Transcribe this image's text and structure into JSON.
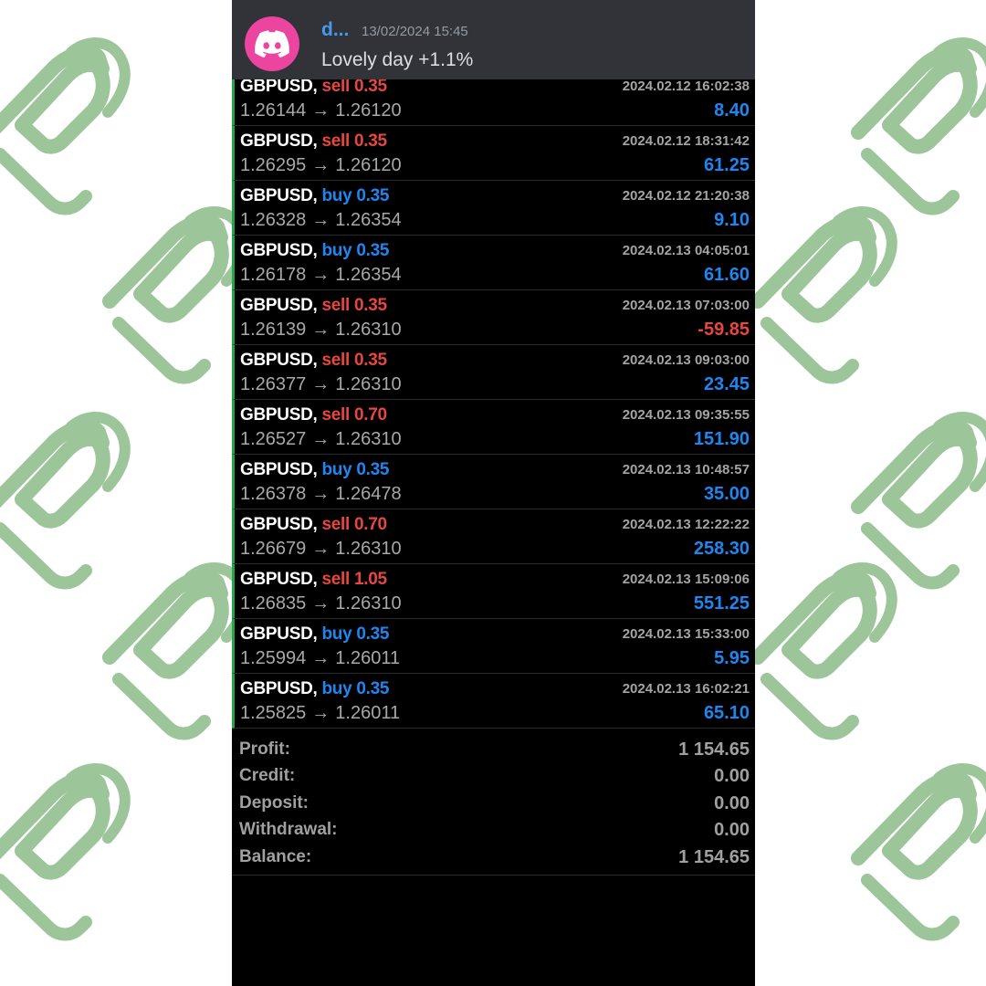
{
  "background": {
    "pattern_icon": "horned-logo-icon",
    "pattern_color": "#9cc59a",
    "page_color": "#ffffff"
  },
  "message": {
    "avatar_icon": "discord-icon",
    "avatar_color": "#eb459f",
    "username": "d...",
    "timestamp": "13/02/2024 15:45",
    "text": "Lovely day +1.1%"
  },
  "colors": {
    "sell": "#e8463e",
    "buy": "#1f86f0",
    "profit_positive": "#1f86f0",
    "profit_negative": "#e8463e"
  },
  "trades": [
    {
      "symbol": "GBPUSD,",
      "side": "sell",
      "lots": "0.35",
      "datetime": "2024.02.12 16:02:38",
      "open": "1.26144",
      "close": "1.26120",
      "arrow": "→",
      "profit": "8.40"
    },
    {
      "symbol": "GBPUSD,",
      "side": "sell",
      "lots": "0.35",
      "datetime": "2024.02.12 18:31:42",
      "open": "1.26295",
      "close": "1.26120",
      "arrow": "→",
      "profit": "61.25"
    },
    {
      "symbol": "GBPUSD,",
      "side": "buy",
      "lots": "0.35",
      "datetime": "2024.02.12 21:20:38",
      "open": "1.26328",
      "close": "1.26354",
      "arrow": "→",
      "profit": "9.10"
    },
    {
      "symbol": "GBPUSD,",
      "side": "buy",
      "lots": "0.35",
      "datetime": "2024.02.13 04:05:01",
      "open": "1.26178",
      "close": "1.26354",
      "arrow": "→",
      "profit": "61.60"
    },
    {
      "symbol": "GBPUSD,",
      "side": "sell",
      "lots": "0.35",
      "datetime": "2024.02.13 07:03:00",
      "open": "1.26139",
      "close": "1.26310",
      "arrow": "→",
      "profit": "-59.85"
    },
    {
      "symbol": "GBPUSD,",
      "side": "sell",
      "lots": "0.35",
      "datetime": "2024.02.13 09:03:00",
      "open": "1.26377",
      "close": "1.26310",
      "arrow": "→",
      "profit": "23.45"
    },
    {
      "symbol": "GBPUSD,",
      "side": "sell",
      "lots": "0.70",
      "datetime": "2024.02.13 09:35:55",
      "open": "1.26527",
      "close": "1.26310",
      "arrow": "→",
      "profit": "151.90"
    },
    {
      "symbol": "GBPUSD,",
      "side": "buy",
      "lots": "0.35",
      "datetime": "2024.02.13 10:48:57",
      "open": "1.26378",
      "close": "1.26478",
      "arrow": "→",
      "profit": "35.00"
    },
    {
      "symbol": "GBPUSD,",
      "side": "sell",
      "lots": "0.70",
      "datetime": "2024.02.13 12:22:22",
      "open": "1.26679",
      "close": "1.26310",
      "arrow": "→",
      "profit": "258.30"
    },
    {
      "symbol": "GBPUSD,",
      "side": "sell",
      "lots": "1.05",
      "datetime": "2024.02.13 15:09:06",
      "open": "1.26835",
      "close": "1.26310",
      "arrow": "→",
      "profit": "551.25"
    },
    {
      "symbol": "GBPUSD,",
      "side": "buy",
      "lots": "0.35",
      "datetime": "2024.02.13 15:33:00",
      "open": "1.25994",
      "close": "1.26011",
      "arrow": "→",
      "profit": "5.95"
    },
    {
      "symbol": "GBPUSD,",
      "side": "buy",
      "lots": "0.35",
      "datetime": "2024.02.13 16:02:21",
      "open": "1.25825",
      "close": "1.26011",
      "arrow": "→",
      "profit": "65.10"
    }
  ],
  "summary": [
    {
      "label": "Profit:",
      "value": "1 154.65"
    },
    {
      "label": "Credit:",
      "value": "0.00"
    },
    {
      "label": "Deposit:",
      "value": "0.00"
    },
    {
      "label": "Withdrawal:",
      "value": "0.00"
    },
    {
      "label": "Balance:",
      "value": "1 154.65"
    }
  ]
}
